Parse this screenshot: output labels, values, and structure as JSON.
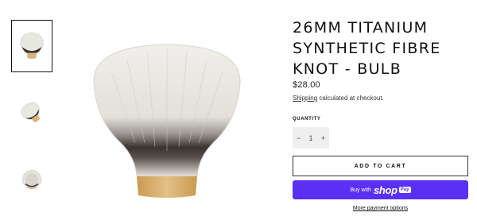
{
  "product": {
    "title": "26MM TITANIUM SYNTHETIC FIBRE KNOT - BULB",
    "price": "$28.00",
    "shipping_link": "Shipping",
    "shipping_rest": " calculated at checkout."
  },
  "quantity": {
    "label": "QUANTITY",
    "value": "1",
    "decrease": "−",
    "increase": "+"
  },
  "buttons": {
    "add_to_cart": "ADD TO CART",
    "buy_with": "Buy with",
    "shop": "shop",
    "pay": "Pay",
    "more_payment": "More payment options"
  },
  "colors": {
    "shoppay": "#5a31f4",
    "knot_hair": "#e9e7e2",
    "knot_band": "#2f2a28",
    "knot_base": "#d8b47a"
  },
  "thumbnails": [
    "brush-knot-front",
    "brush-knot-side",
    "brush-knot-top"
  ]
}
